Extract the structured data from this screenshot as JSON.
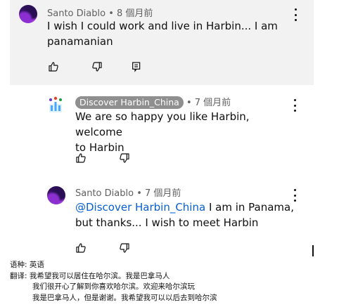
{
  "comments": [
    {
      "author": "Santo Diablo",
      "separator": "•",
      "time": "8 個月前",
      "line1": "I wish I could work and live in Harbin... I am",
      "line2": "panamanian"
    },
    {
      "author": "Discover Harbin_China",
      "separator": "•",
      "time": "7 個月前",
      "line1": "We are so happy you like Harbin, welcome",
      "line2": "to Harbin"
    },
    {
      "author": "Santo Diablo",
      "separator": "•",
      "time": "7 個月前",
      "mention": "@Discover Harbin_China",
      "line1_rest": " I am in Panama,",
      "line2": "but thanks... I wish to meet Harbin"
    }
  ],
  "icons": {
    "like": "thumbs-up-icon",
    "dislike": "thumbs-down-icon",
    "reply": "reply-icon",
    "more": "more-vertical-icon"
  },
  "translation": {
    "language_label": "语种:",
    "language_value": "英语",
    "translate_label": "翻译:",
    "lines": [
      "我希望我可以居住在哈尔滨。我是巴拿马人",
      "我们很开心了解到你喜欢哈尔滨。欢迎来哈尔滨玩",
      "我是巴拿马人，但是谢谢。我希望我可以以后去到哈尔滨"
    ]
  }
}
